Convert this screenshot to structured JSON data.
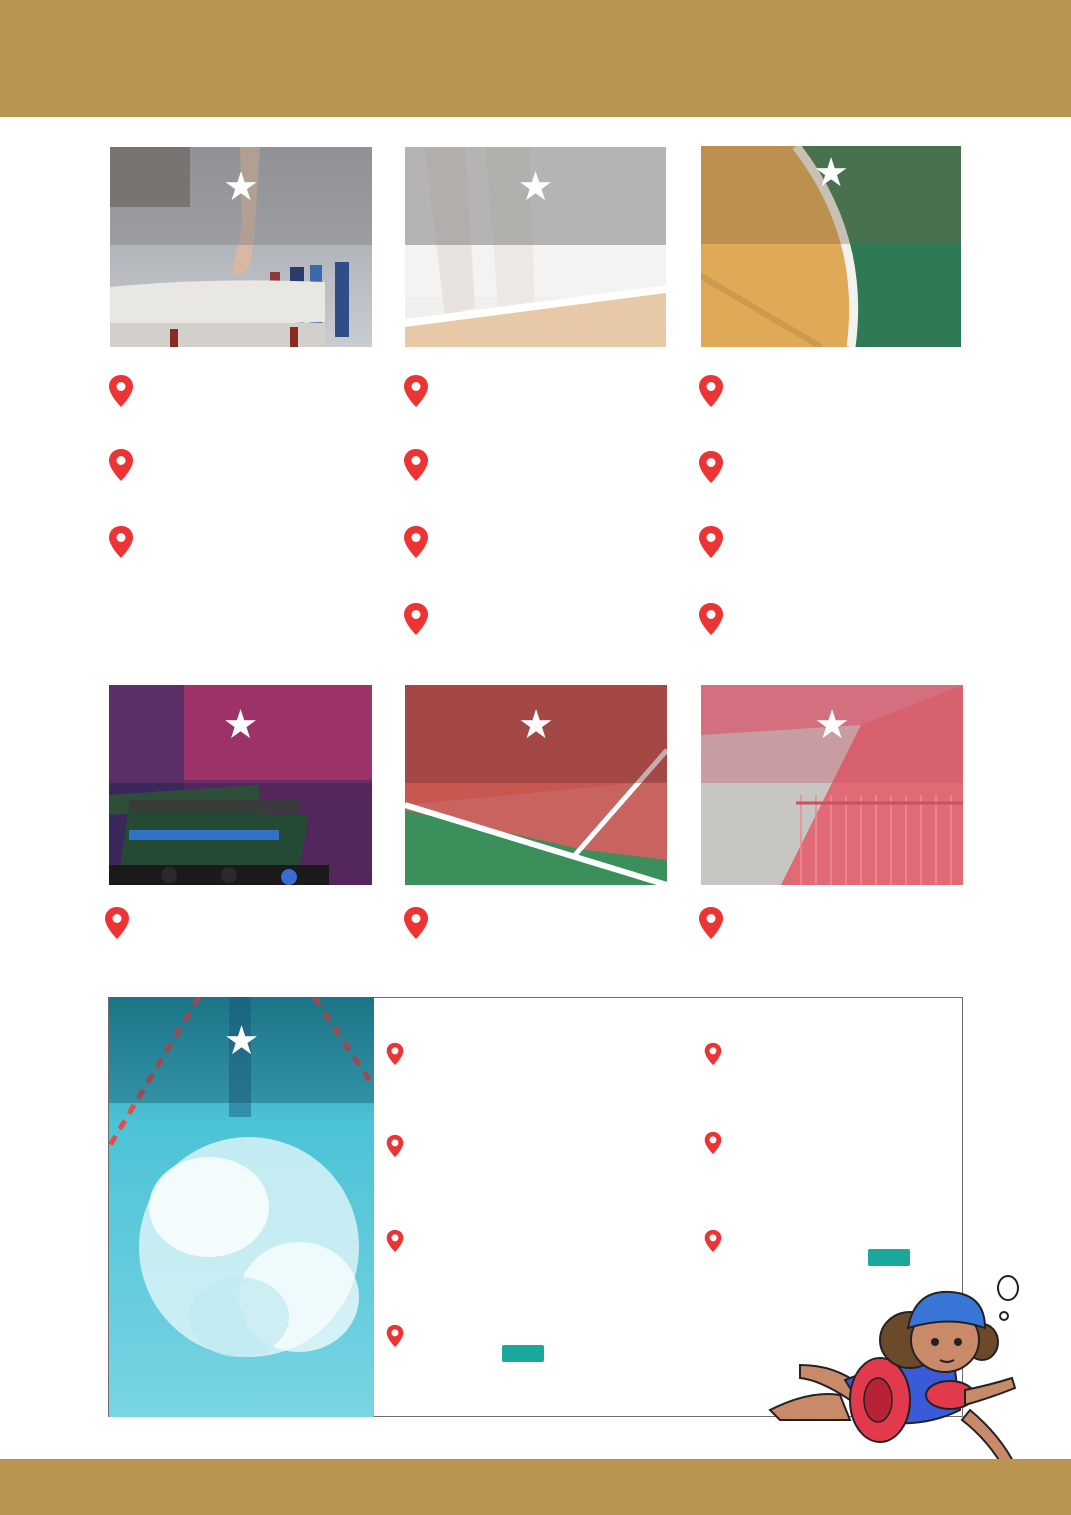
{
  "colors": {
    "band": "#b9954f",
    "pin": "#ec3434",
    "star": "#ffffff",
    "teal": "#1aa79c",
    "border": "#6d6d6d"
  },
  "icons": {
    "star": "★",
    "pin": "map-pin-icon"
  },
  "cards": [
    {
      "sport": "gymnastics-beam",
      "star": "★"
    },
    {
      "sport": "dance",
      "star": "★"
    },
    {
      "sport": "court-green-orange",
      "star": "★"
    },
    {
      "sport": "track-starting-block",
      "star": "★"
    },
    {
      "sport": "tennis-clay-court",
      "star": "★"
    },
    {
      "sport": "judo-mats",
      "star": "★"
    },
    {
      "sport": "swimming-pool",
      "star": "★"
    }
  ]
}
